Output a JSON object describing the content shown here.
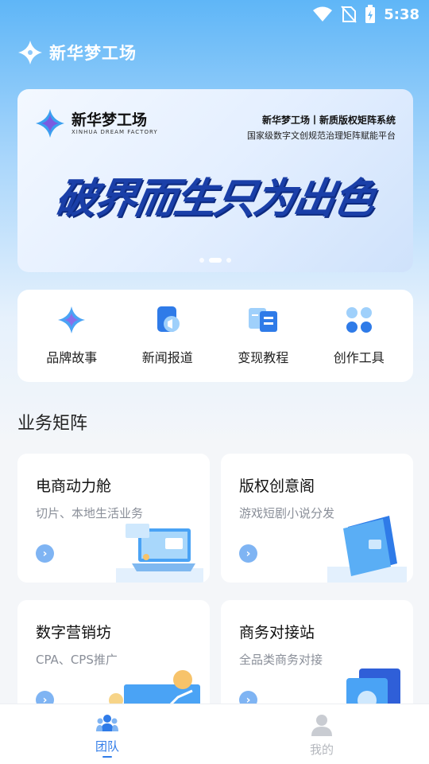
{
  "status_bar": {
    "time": "5:38",
    "icons": [
      "wifi-icon",
      "no-sim-icon",
      "battery-icon"
    ]
  },
  "app": {
    "title": "新华梦工场",
    "logo_icon": "sparkle-logo-icon"
  },
  "banner": {
    "brand": "新华梦工场",
    "brand_sub": "XINHUA DREAM FACTORY",
    "headline": "新华梦工场丨新质版权矩阵系统",
    "subline": "国家级数字文创规范治理矩阵赋能平台",
    "slogan": "破界而生只为出色",
    "slides": 3,
    "active_slide": 2
  },
  "quick_menu": [
    {
      "label": "品牌故事",
      "icon": "sparkle-icon"
    },
    {
      "label": "新闻报道",
      "icon": "megaphone-icon"
    },
    {
      "label": "变现教程",
      "icon": "book-icon"
    },
    {
      "label": "创作工具",
      "icon": "grid-dots-icon"
    }
  ],
  "section": {
    "title": "业务矩阵"
  },
  "cards": [
    {
      "title": "电商动力舱",
      "desc": "切片、本地生活业务",
      "illustration": "laptop-illustration"
    },
    {
      "title": "版权创意阁",
      "desc": "游戏短剧小说分发",
      "illustration": "wallet-illustration"
    },
    {
      "title": "数字营销坊",
      "desc": "CPA、CPS推广",
      "illustration": "coin-chart-illustration"
    },
    {
      "title": "商务对接站",
      "desc": "全品类商务对接",
      "illustration": "device-illustration"
    }
  ],
  "bottom_nav": [
    {
      "label": "团队",
      "icon": "team-icon",
      "active": true
    },
    {
      "label": "我的",
      "icon": "user-icon",
      "active": false
    }
  ],
  "colors": {
    "primary": "#2f7be8",
    "header_gradient_top": "#5fb6f7",
    "arrow_badge": "#7fb4f3"
  }
}
